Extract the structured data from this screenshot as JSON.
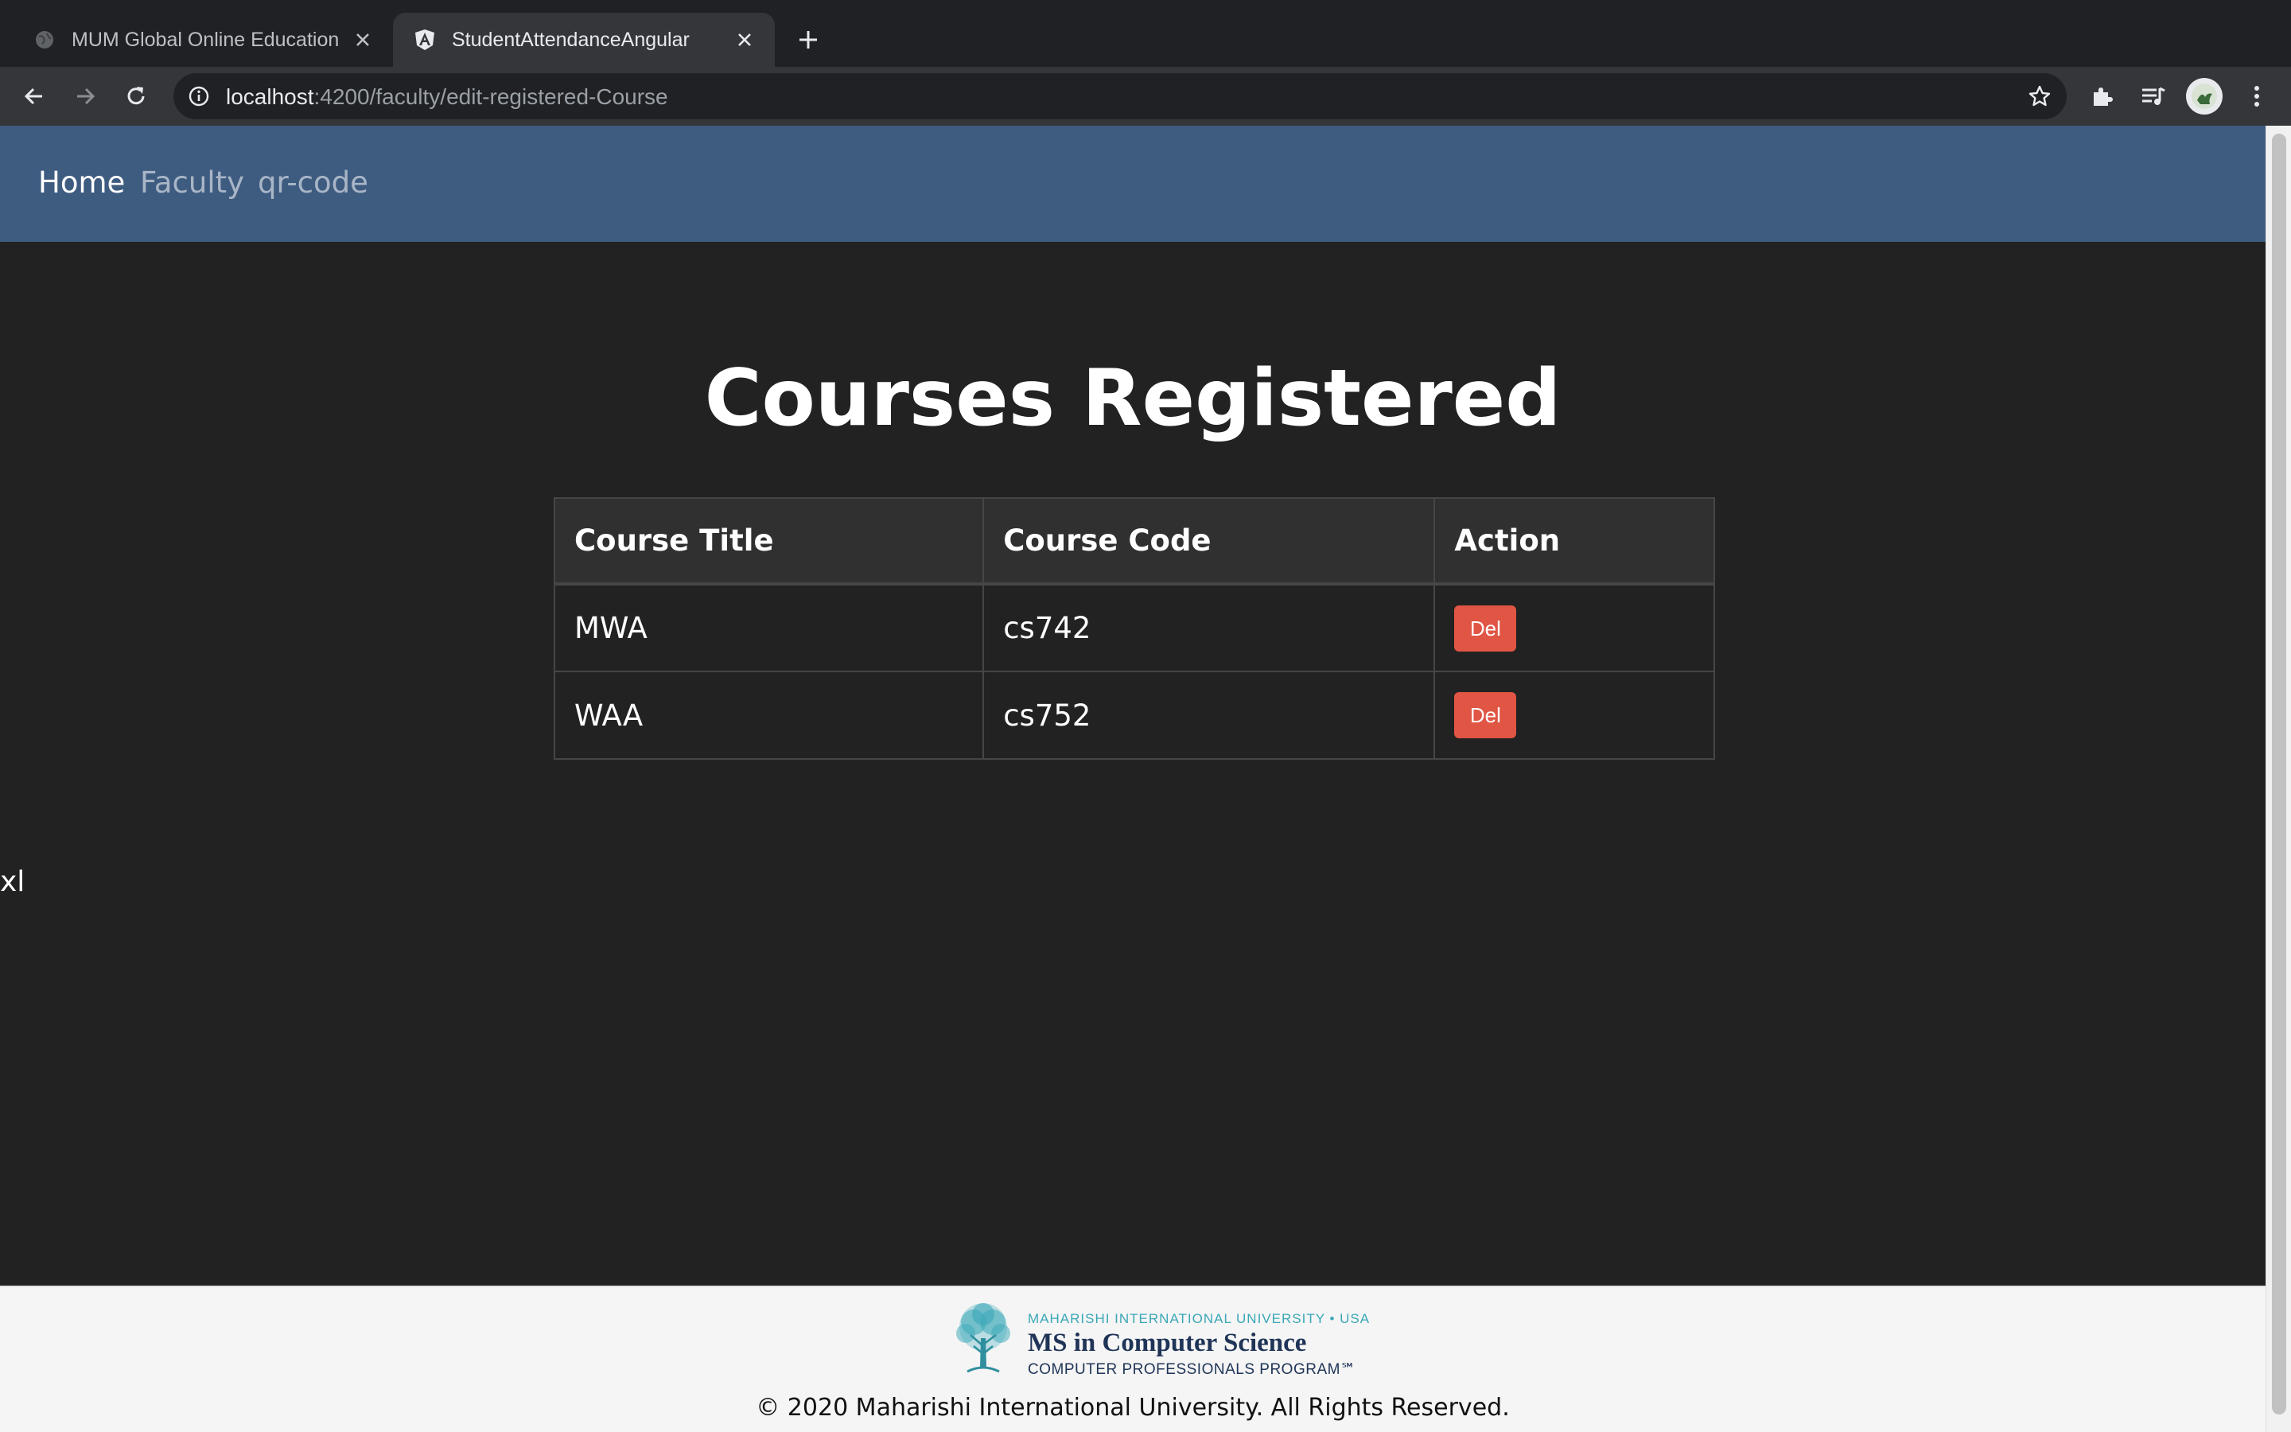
{
  "browser": {
    "tabs": [
      {
        "title": "MUM Global Online Education",
        "active": false,
        "icon": "globe-icon"
      },
      {
        "title": "StudentAttendanceAngular",
        "active": true,
        "icon": "angular-icon"
      }
    ],
    "url_host": "localhost",
    "url_path": ":4200/faculty/edit-registered-Course"
  },
  "nav": {
    "home": "Home",
    "faculty": "Faculty",
    "qr": "qr-code"
  },
  "page": {
    "title": "Courses Registered",
    "stray_text": "xl"
  },
  "table": {
    "headers": [
      "Course Title",
      "Course Code",
      "Action"
    ],
    "rows": [
      {
        "title": "MWA",
        "code": "cs742",
        "action": "Del"
      },
      {
        "title": "WAA",
        "code": "cs752",
        "action": "Del"
      }
    ]
  },
  "footer": {
    "logo_top": "MAHARISHI INTERNATIONAL UNIVERSITY • USA",
    "logo_main": "MS in Computer Science",
    "logo_sub": "COMPUTER PROFESSIONALS PROGRAM℠",
    "copyright": "© 2020 Maharishi International University. All Rights Reserved."
  },
  "colors": {
    "navbar": "#3e5b80",
    "background": "#222222",
    "delete_button": "#e05544"
  }
}
